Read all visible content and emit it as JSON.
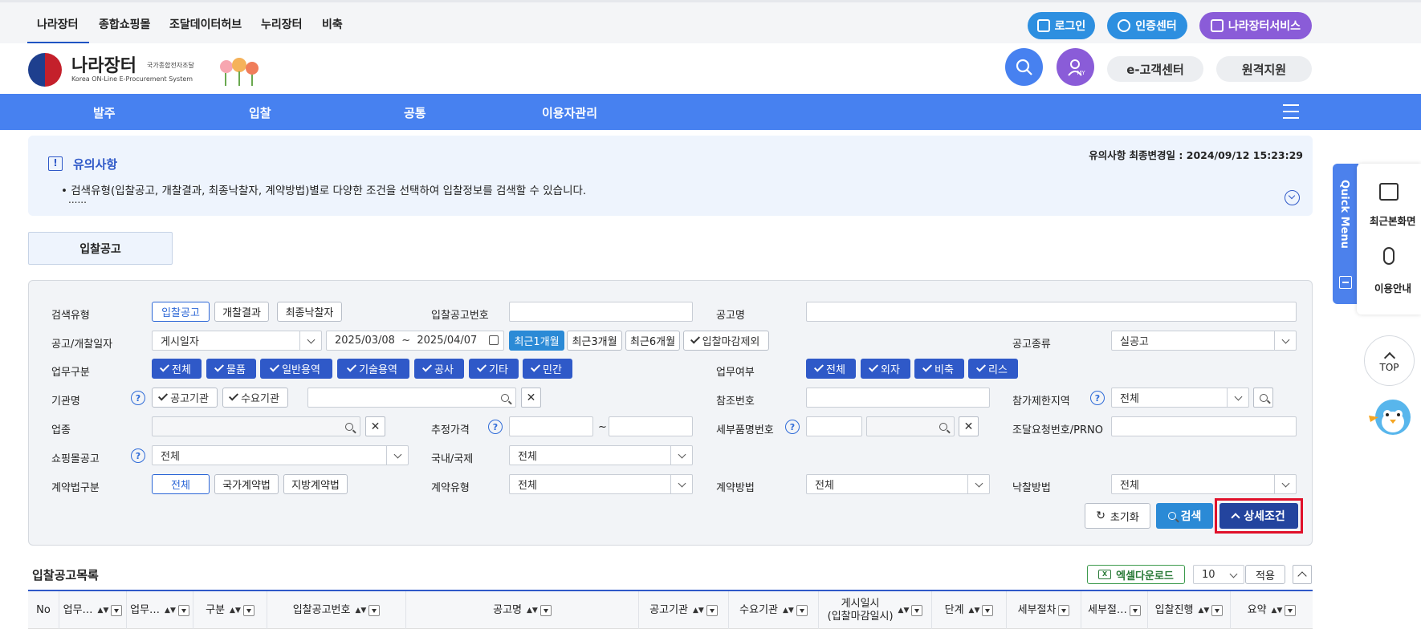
{
  "topbar": {
    "links": [
      "나라장터",
      "종합쇼핑몰",
      "조달데이터허브",
      "누리장터",
      "비축"
    ],
    "login": "로그인",
    "cert": "인증센터",
    "services": "나라장터서비스"
  },
  "brand": {
    "name": "나라장터",
    "sub1": "국가종합전자조달",
    "sub2": "Korea ON-Line E-Procurement System"
  },
  "header": {
    "my_label": "MY",
    "customer": "e-고객센터",
    "remote": "원격지원"
  },
  "nav": {
    "items": [
      "발주",
      "입찰",
      "공통",
      "이용자관리"
    ]
  },
  "notice": {
    "title": "유의사항",
    "updated": "유의사항 최종변경일 : 2024/09/12 15:23:29",
    "line1": "검색유형(입찰공고, 개찰결과, 최종낙찰자, 계약방법)별로 다양한 조건을 선택하여 입찰정보를 검색할 수 있습니다.",
    "line2": "......"
  },
  "tab": "입찰공고",
  "form": {
    "labels": {
      "search_type": "검색유형",
      "bid_no": "입찰공고번호",
      "title": "공고명",
      "date": "공고/개찰일자",
      "kind": "공고종류",
      "biz": "업무구분",
      "biz_yn": "업무여부",
      "org": "기관명",
      "ref": "참조번호",
      "region": "참가제한지역",
      "industry": "업종",
      "est_price": "추정가격",
      "detail_no": "세부품명번호",
      "req_no": "조달요청번호/PRNO",
      "mall": "쇼핑몰공고",
      "domestic": "국내/국제",
      "law": "계약법구분",
      "contract_type": "계약유형",
      "contract_method": "계약방법",
      "award_method": "낙찰방법"
    },
    "search_types": [
      "입찰공고",
      "개찰결과",
      "최종낙찰자"
    ],
    "date_select": "게시일자",
    "date_from": "2025/03/08",
    "date_sep": "~",
    "date_to": "2025/04/07",
    "periods": [
      "최근1개월",
      "최근3개월",
      "최근6개월"
    ],
    "exclude_closed": "입찰마감제외",
    "kind_value": "실공고",
    "biz_items": [
      "전체",
      "물품",
      "일반용역",
      "기술용역",
      "공사",
      "기타",
      "민간"
    ],
    "biz_yn_items": [
      "전체",
      "외자",
      "비축",
      "리스"
    ],
    "org_checks": [
      "공고기관",
      "수요기관"
    ],
    "region_value": "전체",
    "range_sep": "~",
    "mall_value": "전체",
    "domestic_value": "전체",
    "law_items": [
      "전체",
      "국가계약법",
      "지방계약법"
    ],
    "contract_type_value": "전체",
    "contract_method_value": "전체",
    "award_method_value": "전체",
    "reset": "초기화",
    "search": "검색",
    "detail": "상세조건"
  },
  "quick": {
    "title": "Quick Menu",
    "recent": "최근본화면",
    "guide": "이용안내",
    "top": "TOP"
  },
  "list": {
    "title": "입찰공고목록",
    "excel": "엑셀다운로드",
    "page_size": "10",
    "apply": "적용",
    "columns": [
      "No",
      "업무…",
      "업무…",
      "구분",
      "입찰공고번호",
      "공고명",
      "공고기관",
      "수요기관",
      "게시일시",
      "(입찰마감일시)",
      "단계",
      "세부절차",
      "세부절…",
      "입찰진행",
      "요약"
    ]
  },
  "colors": {
    "accent": "#2f59c8",
    "nav": "#4781f0",
    "highlight": "#e0102a"
  }
}
